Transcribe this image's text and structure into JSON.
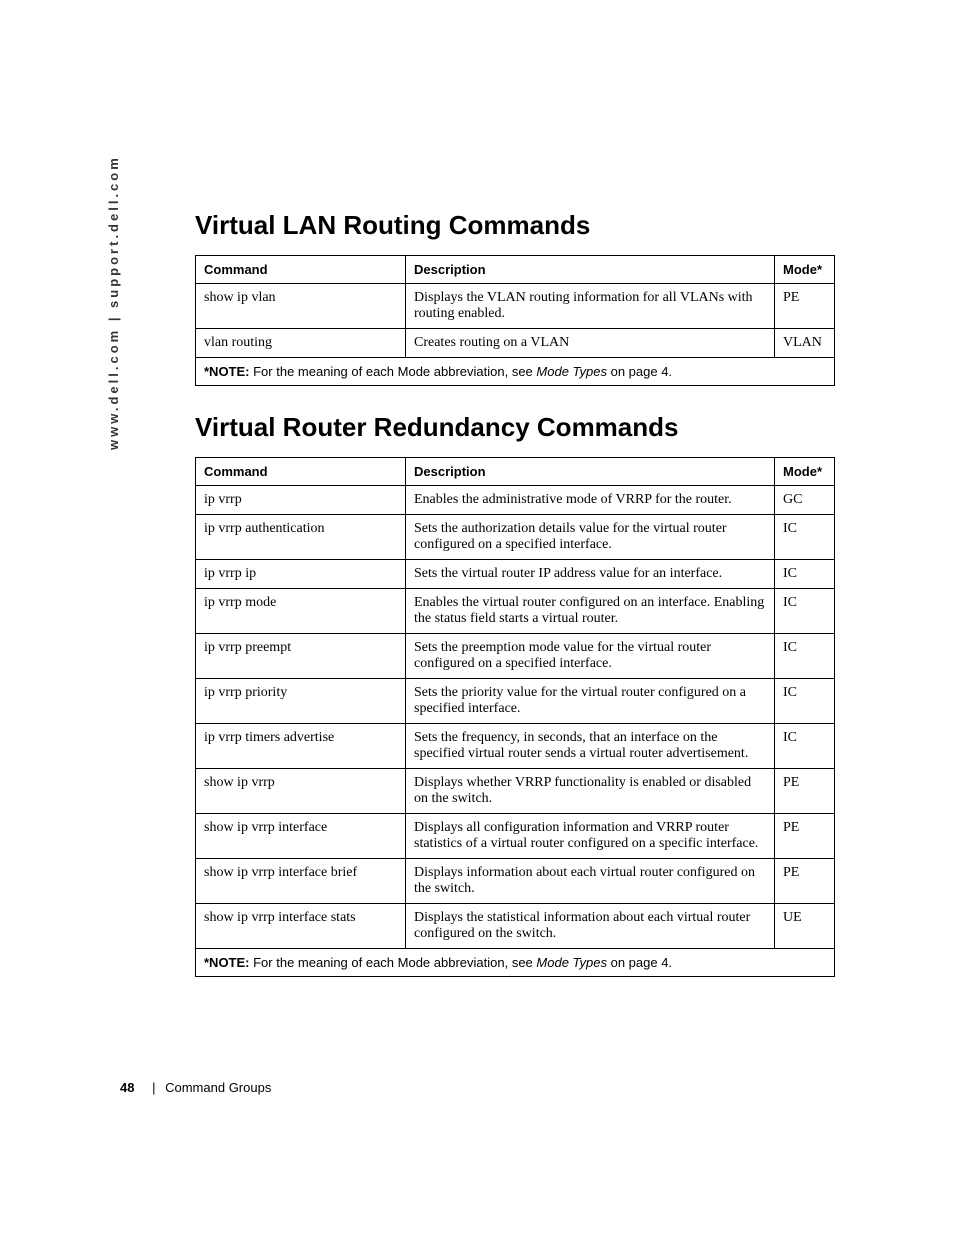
{
  "side_url": "www.dell.com | support.dell.com",
  "headers": {
    "command": "Command",
    "description": "Description",
    "mode": "Mode*"
  },
  "section1": {
    "title": "Virtual LAN Routing Commands",
    "rows": [
      {
        "cmd": "show ip vlan",
        "desc": "Displays the VLAN routing information for all VLANs with routing enabled.",
        "mode": "PE"
      },
      {
        "cmd": "vlan routing",
        "desc": "Creates routing on a VLAN",
        "mode": "VLAN"
      }
    ]
  },
  "section2": {
    "title": "Virtual Router Redundancy Commands",
    "rows": [
      {
        "cmd": "ip vrrp",
        "desc": "Enables the administrative mode of VRRP for the router.",
        "mode": "GC"
      },
      {
        "cmd": "ip vrrp authentication",
        "desc": "Sets the authorization details value for the virtual router configured on a specified interface.",
        "mode": "IC"
      },
      {
        "cmd": "ip vrrp ip",
        "desc": "Sets the virtual router IP address value for an interface.",
        "mode": "IC"
      },
      {
        "cmd": "ip vrrp mode",
        "desc": "Enables the virtual router configured on an interface. Enabling the status field starts a virtual router.",
        "mode": "IC"
      },
      {
        "cmd": "ip vrrp preempt",
        "desc": "Sets the preemption mode value for the virtual router configured on a specified interface.",
        "mode": "IC"
      },
      {
        "cmd": "ip vrrp priority",
        "desc": "Sets the priority value for the virtual router configured on a specified interface.",
        "mode": "IC"
      },
      {
        "cmd": "ip vrrp timers advertise",
        "desc": "Sets the frequency, in seconds, that an interface on the specified virtual router sends a virtual router advertisement.",
        "mode": "IC"
      },
      {
        "cmd": "show ip vrrp",
        "desc": "Displays whether VRRP functionality is enabled or disabled on the switch.",
        "mode": "PE"
      },
      {
        "cmd": "show ip vrrp interface",
        "desc": "Displays all configuration information and VRRP router statistics of a virtual router configured on a specific interface.",
        "mode": "PE"
      },
      {
        "cmd": "show ip vrrp interface brief",
        "desc": "Displays information about each virtual router configured on the switch.",
        "mode": "PE"
      },
      {
        "cmd": "show ip vrrp interface stats",
        "desc": "Displays the statistical information about each virtual router configured on the switch.",
        "mode": "UE"
      }
    ]
  },
  "note": {
    "label": "*NOTE:",
    "text_before": " For the meaning of each Mode abbreviation, see ",
    "italic": "Mode Types",
    "text_after": " on page 4."
  },
  "footer": {
    "page": "48",
    "separator": "|",
    "section": "Command Groups"
  }
}
